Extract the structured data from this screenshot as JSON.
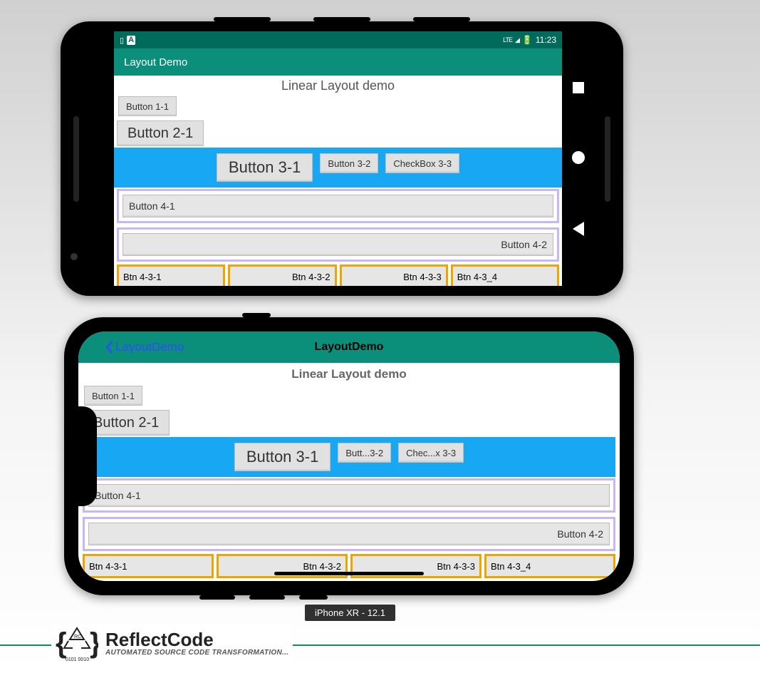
{
  "android": {
    "status_time": "11:23",
    "status_lte": "LTE",
    "appbar_title": "Layout Demo",
    "section_title": "Linear Layout demo",
    "btn_1_1": "Button 1-1",
    "btn_2_1": "Button 2-1",
    "btn_3_1": "Button 3-1",
    "btn_3_2": "Button 3-2",
    "chk_3_3": "CheckBox 3-3",
    "btn_4_1": "Button 4-1",
    "btn_4_2": "Button 4-2",
    "btn_4_3_1": "Btn 4-3-1",
    "btn_4_3_2": "Btn 4-3-2",
    "btn_4_3_3": "Btn 4-3-3",
    "btn_4_3_4": "Btn 4-3_4"
  },
  "ios": {
    "back_label": "LayoutDemo",
    "nav_title": "LayoutDemo",
    "section_title": "Linear Layout demo",
    "btn_1_1": "Button 1-1",
    "btn_2_1": "Button 2-1",
    "btn_3_1": "Button 3-1",
    "btn_3_2": "Butt...3-2",
    "chk_3_3": "Chec...x 3-3",
    "btn_4_1": "Button 4-1",
    "btn_4_2": "Button 4-2",
    "btn_4_3_1": "Btn 4-3-1",
    "btn_4_3_2": "Btn 4-3-2",
    "btn_4_3_3": "Btn 4-3-3",
    "btn_4_3_4": "Btn 4-3_4"
  },
  "device_caption": "iPhone XR - 12.1",
  "brand": {
    "name": "ReflectCode",
    "tagline": "AUTOMATED SOURCE CODE TRANSFORMATION...",
    "logo_small": "RC",
    "logo_bits": "0101 0010"
  }
}
